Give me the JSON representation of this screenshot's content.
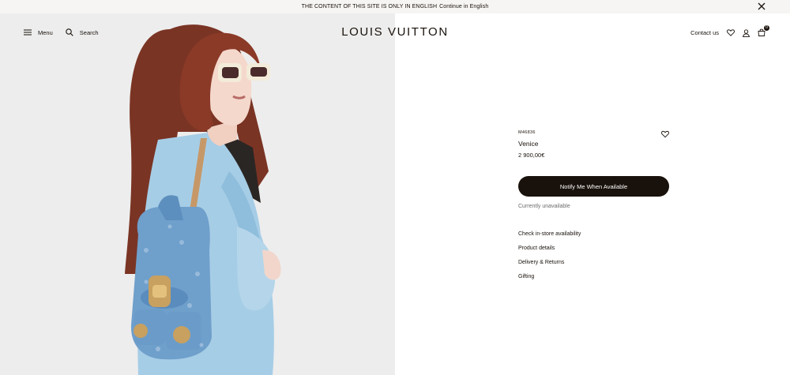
{
  "banner": {
    "text": "THE CONTENT OF THIS SITE IS ONLY IN ENGLISH",
    "link": "Continue in English"
  },
  "header": {
    "menu_label": "Menu",
    "search_label": "Search",
    "logo": "LOUIS VUITTON",
    "contact_label": "Contact us",
    "bag_count": "0"
  },
  "product": {
    "sku": "M46836",
    "name": "Venice",
    "price": "2 900,00€",
    "notify_label": "Notify Me When Available",
    "availability": "Currently unavailable",
    "links": [
      "Check in-store availability",
      "Product details",
      "Delivery & Returns",
      "Gifting"
    ]
  },
  "colors": {
    "ink": "#19110b",
    "banner_bg": "#f6f5f3",
    "muted": "#6b6b6b"
  }
}
